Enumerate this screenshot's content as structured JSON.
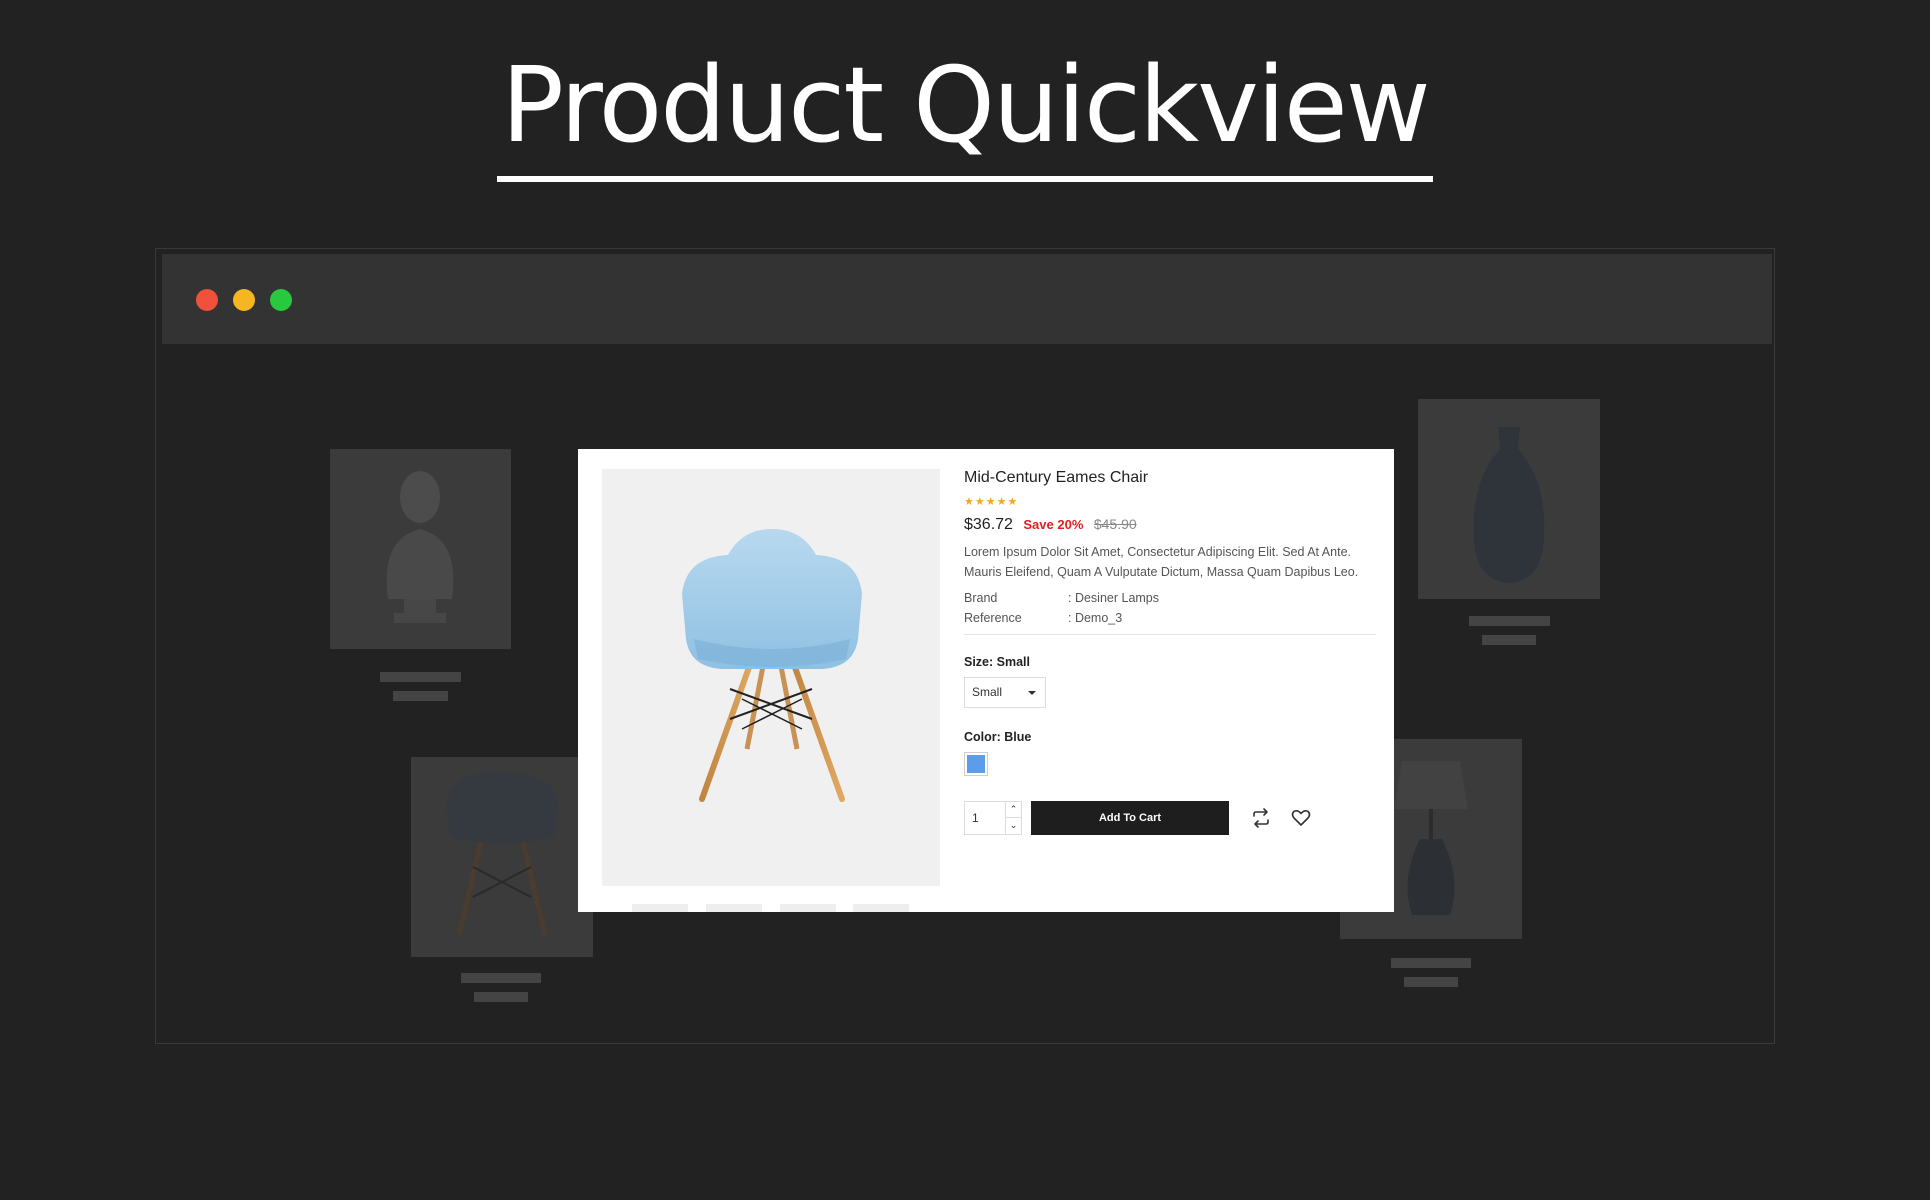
{
  "page_heading": "Product Quickview",
  "window_controls": {
    "close_color": "#f0513c",
    "minimize_color": "#f5b622",
    "maximize_color": "#28c83f"
  },
  "product": {
    "title": "Mid-Century Eames Chair",
    "rating": 5,
    "rating_max": 5,
    "star_glyph": "★",
    "price": "$36.72",
    "save_label": "Save 20%",
    "old_price": "$45.90",
    "description": "Lorem Ipsum Dolor Sit Amet, Consectetur Adipiscing Elit. Sed At Ante. Mauris Eleifend, Quam A Vulputate Dictum, Massa Quam Dapibus Leo.",
    "details": [
      {
        "label": "Brand",
        "value": ": Desiner Lamps"
      },
      {
        "label": "Reference",
        "value": ": Demo_3"
      }
    ],
    "size": {
      "label": "Size: Small",
      "selected": "Small"
    },
    "color": {
      "label": "Color: Blue",
      "swatch": "#5b9de8"
    },
    "quantity": "1",
    "add_to_cart": "Add To Cart",
    "icons": [
      "compare-icon",
      "wishlist-icon"
    ]
  }
}
